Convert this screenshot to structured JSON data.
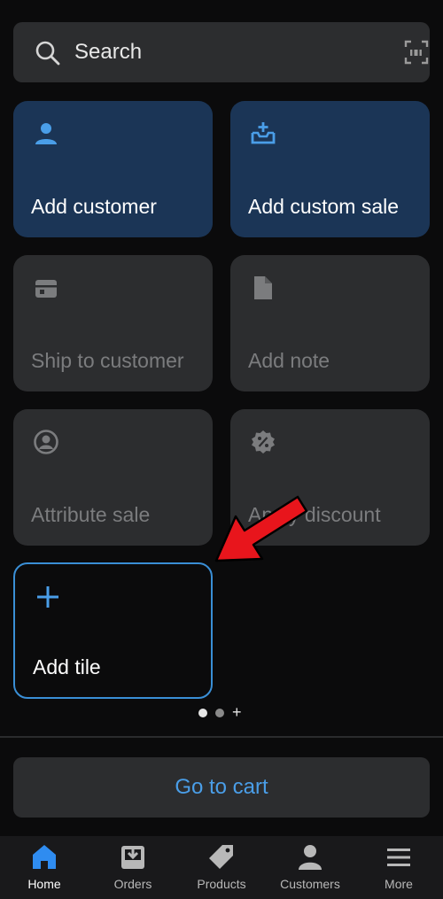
{
  "search": {
    "placeholder": "Search"
  },
  "tiles": [
    {
      "label": "Add customer",
      "icon": "person-icon",
      "state": "active"
    },
    {
      "label": "Add custom sale",
      "icon": "add-to-tray-icon",
      "state": "active"
    },
    {
      "label": "Ship to customer",
      "icon": "shipping-icon",
      "state": "disabled"
    },
    {
      "label": "Add note",
      "icon": "document-icon",
      "state": "disabled"
    },
    {
      "label": "Attribute sale",
      "icon": "account-circle-icon",
      "state": "disabled"
    },
    {
      "label": "Apply discount",
      "icon": "discount-badge-icon",
      "state": "disabled"
    },
    {
      "label": "Add tile",
      "icon": "plus-icon",
      "state": "outline"
    }
  ],
  "pager": {
    "pages": 2,
    "current": 1,
    "add_symbol": "+"
  },
  "cart_button": {
    "label": "Go to cart"
  },
  "nav": {
    "items": [
      {
        "label": "Home",
        "icon": "home-icon"
      },
      {
        "label": "Orders",
        "icon": "orders-inbox-icon"
      },
      {
        "label": "Products",
        "icon": "tag-icon"
      },
      {
        "label": "Customers",
        "icon": "person-icon"
      },
      {
        "label": "More",
        "icon": "menu-icon"
      }
    ],
    "current": "Home"
  },
  "colors": {
    "background": "#0b0b0c",
    "surface": "#2c2d2f",
    "active_tile": "#1b3556",
    "accent": "#4a9ee8",
    "annotation_arrow": "#e8151c"
  }
}
